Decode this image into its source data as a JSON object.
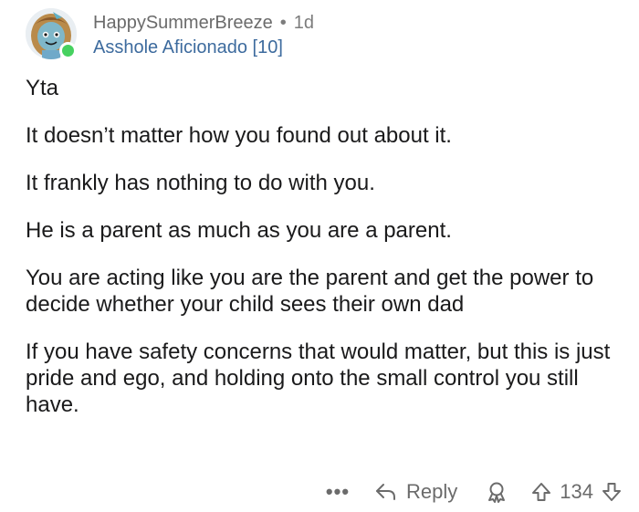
{
  "comment": {
    "username": "HappySummerBreeze",
    "separator": "•",
    "age": "1d",
    "flair": "Asshole Aficionado [10]",
    "paragraphs": [
      "Yta",
      "It doesn’t matter how you found out about it.",
      "It frankly has nothing to do with you.",
      "He is a parent as much as you are a parent.",
      "You are acting like you are the parent and get the power to decide whether your child sees their own dad",
      "If you have safety concerns that would matter, but this is just pride and ego, and holding onto the small control you still have."
    ]
  },
  "actions": {
    "more_label": "•••",
    "reply_label": "Reply",
    "vote_count": "134"
  },
  "icons": {
    "more": "more-options-icon",
    "reply": "reply-arrow-icon",
    "award": "award-icon",
    "upvote": "upvote-arrow-icon",
    "downvote": "downvote-arrow-icon"
  },
  "colors": {
    "online": "#46d160",
    "flair": "#3d6b9e",
    "meta": "#7c7c7c",
    "text": "#1a1a1b"
  }
}
